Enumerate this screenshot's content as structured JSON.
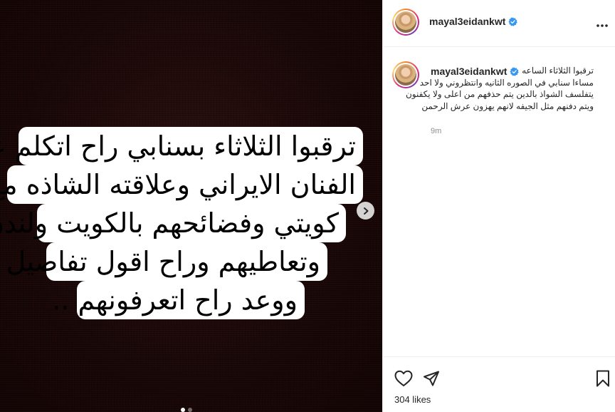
{
  "media": {
    "caption_lines": [
      "ترقبوا الثلاثاء بسنابي راح اتكلم عن",
      "الفنان الايراني وعلاقته الشاذه مع فنان",
      "كويتي وفضائحهم بالكويت ولندن",
      "وتعاطيهم وراح اقول تفاصيل",
      "ووعد راح اتعرفونهم .."
    ],
    "carousel_dots": 2,
    "active_dot": 0
  },
  "header": {
    "username": "mayal3eidankwt",
    "verified": true
  },
  "comment": {
    "username": "mayal3eidankwt",
    "lines": [
      "ترقبوا الثلاثاء الساعه ٩",
      "مساءا سنابي في الصوره الثانيه وانتظروني ولا احد",
      "يتفلسف الشواذ بالدين يتم حذفهم من اعلى ولا يكفنون",
      "ويتم دفنهم مثل الجيفه لانهم يهزون عرش الرحمن"
    ],
    "time": "9m"
  },
  "footer": {
    "likes_label": "304 likes"
  },
  "colors": {
    "verified_blue": "#3897f0",
    "text": "#262626",
    "muted": "#8e8e8e",
    "media_bg": "#1a0707"
  },
  "icons": [
    "verified-icon",
    "more-options-icon",
    "chevron-right-icon",
    "heart-icon",
    "send-icon",
    "bookmark-icon"
  ]
}
